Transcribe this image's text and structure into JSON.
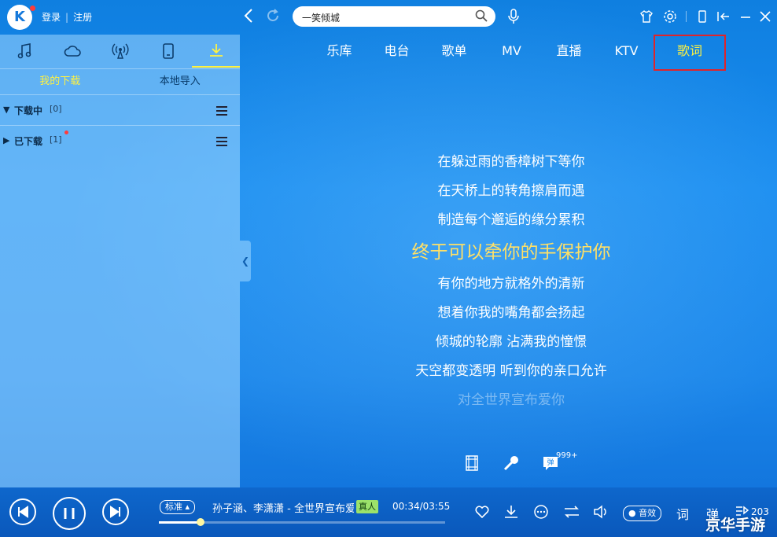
{
  "topbar": {
    "logo": "K",
    "login": "登录",
    "separator": "|",
    "register": "注册",
    "search_value": "一笑倾城"
  },
  "left_panel": {
    "subtabs": [
      "我的下载",
      "本地导入"
    ],
    "downloading": {
      "label": "下载中",
      "count": "[0]"
    },
    "downloaded": {
      "label": "已下载",
      "count": "[1]"
    }
  },
  "main_nav": [
    "乐库",
    "电台",
    "歌单",
    "MV",
    "直播",
    "KTV",
    "歌词"
  ],
  "lyrics": {
    "lines": [
      "在躲过雨的香樟树下等你",
      "在天桥上的转角擦肩而遇",
      "制造每个邂逅的缘分累积",
      "终于可以牵你的手保护你",
      "有你的地方就格外的清新",
      "想着你我的嘴角都会扬起",
      "倾城的轮廓 沾满我的憧憬",
      "天空都变透明 听到你的亲口允许",
      "对全世界宣布爱你"
    ],
    "current_index": 3,
    "comment_badge": "999+",
    "danmaku_glyph": "弹"
  },
  "player": {
    "quality": "标准",
    "song": "孙子涵、李潇潇 - 全世界宣布爱你",
    "real_badge": "真人",
    "time": "00:34/03:55",
    "progress": 0.145,
    "sound_effect": "音效",
    "lyric_btn": "词",
    "danmaku_btn": "弹",
    "playlist_count": "203"
  },
  "watermark": "京华手游"
}
